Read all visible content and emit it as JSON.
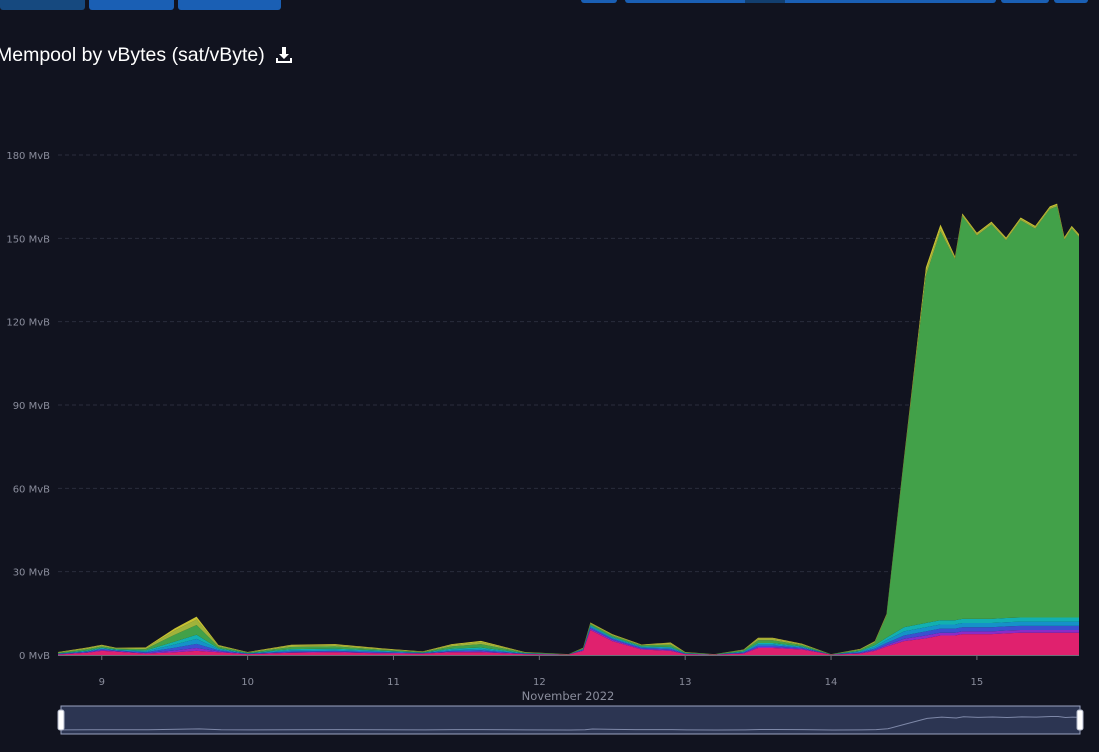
{
  "header": {
    "title": "Mempool by vBytes (sat/vByte)",
    "download_icon": "download-icon"
  },
  "colors": {
    "background": "#11131f",
    "button": "#1a5fb4",
    "grid": "#2a2d3d",
    "tick_text": "#8a8d9c",
    "series_low": "#e0216e",
    "series_mid1": "#8b2bc8",
    "series_mid2": "#3b4fd0",
    "series_mid3": "#1592c8",
    "series_mid4": "#12b0b0",
    "series_main": "#42a149",
    "series_top1": "#9fb33b",
    "series_top2": "#c8c232"
  },
  "chart_data": {
    "type": "area",
    "stacked": true,
    "title": "Mempool by vBytes (sat/vByte)",
    "xlabel": "November 2022",
    "ylabel": "",
    "x_ticks": [
      "9",
      "10",
      "11",
      "12",
      "13",
      "14",
      "15"
    ],
    "y_ticks": [
      "0 MvB",
      "30 MvB",
      "60 MvB",
      "90 MvB",
      "120 MvB",
      "150 MvB",
      "180 MvB"
    ],
    "xlim": [
      8.7,
      15.7
    ],
    "ylim": [
      0,
      180
    ],
    "grid": true,
    "x": [
      8.7,
      8.9,
      9.0,
      9.1,
      9.3,
      9.5,
      9.65,
      9.8,
      10.0,
      10.3,
      10.6,
      10.9,
      11.2,
      11.4,
      11.6,
      11.9,
      12.2,
      12.3,
      12.35,
      12.5,
      12.7,
      12.9,
      13.0,
      13.2,
      13.4,
      13.5,
      13.6,
      13.8,
      14.0,
      14.2,
      14.3,
      14.38,
      14.5,
      14.65,
      14.75,
      14.85,
      14.9,
      15.0,
      15.1,
      15.2,
      15.3,
      15.4,
      15.5,
      15.55,
      15.6,
      15.65,
      15.7
    ],
    "series": [
      {
        "values": [
          0.2,
          0.8,
          1.5,
          1.2,
          0.5,
          1.0,
          1.5,
          1.0,
          0.3,
          0.8,
          1.0,
          0.6,
          0.5,
          1.0,
          1.0,
          0.3,
          0.2,
          1.5,
          9.0,
          5.0,
          2.0,
          1.5,
          0.3,
          0.2,
          0.5,
          2.5,
          2.5,
          2.0,
          0.2,
          0.5,
          1.5,
          3.0,
          5.0,
          6.0,
          7.0,
          7.0,
          7.5,
          7.5,
          7.5,
          7.8,
          8.0,
          8.0,
          8.0,
          8.0,
          8.0,
          8.0,
          8.0
        ]
      },
      {
        "values": [
          0.1,
          0.2,
          0.3,
          0.2,
          0.2,
          0.6,
          1.0,
          0.3,
          0.1,
          0.2,
          0.2,
          0.2,
          0.1,
          0.2,
          0.3,
          0.1,
          0.0,
          0.2,
          0.5,
          0.5,
          0.3,
          0.3,
          0.1,
          0.0,
          0.2,
          0.4,
          0.4,
          0.3,
          0.0,
          0.2,
          0.3,
          0.5,
          0.8,
          1.0,
          1.0,
          1.0,
          1.0,
          1.0,
          1.0,
          1.0,
          1.0,
          1.0,
          1.0,
          1.0,
          1.0,
          1.0,
          1.0
        ]
      },
      {
        "values": [
          0.1,
          0.2,
          0.3,
          0.2,
          0.3,
          1.0,
          1.5,
          0.4,
          0.1,
          0.3,
          0.3,
          0.3,
          0.1,
          0.3,
          0.4,
          0.1,
          0.0,
          0.2,
          0.5,
          0.4,
          0.3,
          0.4,
          0.1,
          0.0,
          0.2,
          0.5,
          0.5,
          0.3,
          0.0,
          0.3,
          0.5,
          0.8,
          1.2,
          1.5,
          1.5,
          1.5,
          1.5,
          1.5,
          1.5,
          1.5,
          1.5,
          1.5,
          1.5,
          1.5,
          1.5,
          1.5,
          1.5
        ]
      },
      {
        "values": [
          0.1,
          0.2,
          0.3,
          0.2,
          0.3,
          1.2,
          1.8,
          0.4,
          0.1,
          0.4,
          0.4,
          0.3,
          0.1,
          0.4,
          0.5,
          0.1,
          0.0,
          0.2,
          0.4,
          0.3,
          0.3,
          0.4,
          0.1,
          0.0,
          0.2,
          0.5,
          0.5,
          0.3,
          0.0,
          0.3,
          0.6,
          1.0,
          1.5,
          1.5,
          1.5,
          1.5,
          1.5,
          1.5,
          1.5,
          1.5,
          1.5,
          1.5,
          1.5,
          1.5,
          1.5,
          1.5,
          1.5
        ]
      },
      {
        "values": [
          0.1,
          0.2,
          0.2,
          0.2,
          0.3,
          1.0,
          1.5,
          0.3,
          0.1,
          0.4,
          0.4,
          0.2,
          0.1,
          0.4,
          0.5,
          0.1,
          0.0,
          0.1,
          0.3,
          0.3,
          0.2,
          0.3,
          0.1,
          0.0,
          0.2,
          0.4,
          0.4,
          0.2,
          0.0,
          0.2,
          0.6,
          0.9,
          1.5,
          1.5,
          1.5,
          1.5,
          1.5,
          1.5,
          1.5,
          1.5,
          1.5,
          1.5,
          1.5,
          1.5,
          1.5,
          1.5,
          1.5
        ]
      },
      {
        "values": [
          0.2,
          0.5,
          0.5,
          0.3,
          0.5,
          2.5,
          3.5,
          0.6,
          0.2,
          0.8,
          0.8,
          0.4,
          0.2,
          0.8,
          1.2,
          0.2,
          0.1,
          0.2,
          0.5,
          0.5,
          0.4,
          0.8,
          0.2,
          0.1,
          0.4,
          1.0,
          1.0,
          0.5,
          0.1,
          0.4,
          1.0,
          8.0,
          60.0,
          125.0,
          140.0,
          130.0,
          145.0,
          138.0,
          142.0,
          136.0,
          143.0,
          140.0,
          147.0,
          148.0,
          136.0,
          140.0,
          137.0
        ]
      },
      {
        "values": [
          0.2,
          0.4,
          0.4,
          0.2,
          0.4,
          1.5,
          2.0,
          0.4,
          0.1,
          0.5,
          0.5,
          0.3,
          0.1,
          0.5,
          0.8,
          0.1,
          0.0,
          0.1,
          0.3,
          0.3,
          0.2,
          0.5,
          0.1,
          0.0,
          0.2,
          0.6,
          0.6,
          0.3,
          0.0,
          0.2,
          0.3,
          0.3,
          0.5,
          1.5,
          1.0,
          0.5,
          0.5,
          0.5,
          0.5,
          0.5,
          0.5,
          0.5,
          0.5,
          0.5,
          0.5,
          0.5,
          0.5
        ]
      },
      {
        "values": [
          0.1,
          0.2,
          0.2,
          0.1,
          0.2,
          0.8,
          1.0,
          0.2,
          0.1,
          0.3,
          0.3,
          0.2,
          0.1,
          0.3,
          0.4,
          0.1,
          0.0,
          0.1,
          0.2,
          0.2,
          0.1,
          0.3,
          0.1,
          0.0,
          0.1,
          0.3,
          0.3,
          0.2,
          0.0,
          0.1,
          0.2,
          0.2,
          0.5,
          1.5,
          1.5,
          0.5,
          0.5,
          0.5,
          0.5,
          0.5,
          0.5,
          0.5,
          0.5,
          0.5,
          0.5,
          0.5,
          0.5
        ]
      }
    ],
    "overview": {
      "range_start": 0,
      "range_end": 100
    }
  }
}
